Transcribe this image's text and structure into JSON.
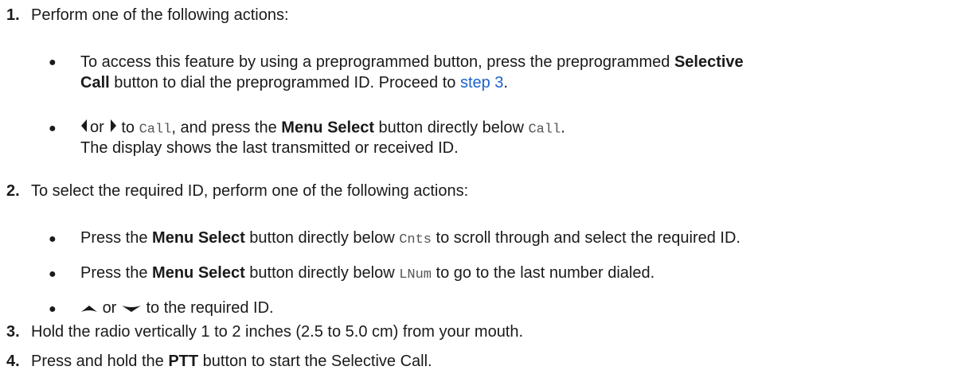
{
  "steps": [
    {
      "number": "1.",
      "text": "Perform one of the following actions:",
      "bullets": [
        {
          "line1_pre": "To access this feature by using a preprogrammed button, press the preprogrammed ",
          "line1_bold": "Selective",
          "line2_bold": "Call",
          "line2_mid": " button to dial the preprogrammed ID. Proceed to ",
          "link": "step 3",
          "line2_end": "."
        },
        {
          "icon_left": "left-arrow-icon",
          "or": "or",
          "icon_right": "right-arrow-icon",
          "to": "to",
          "code1": "Call",
          "mid": ", and press the ",
          "bold": "Menu Select",
          "after": " button directly below ",
          "code2": "Call",
          "end": ".",
          "line2": "The display shows the last transmitted or received ID."
        }
      ]
    },
    {
      "number": "2.",
      "text": "To select the required ID, perform one of the following actions:",
      "bullets": [
        {
          "pre": "Press the ",
          "bold": "Menu Select",
          "mid": " button directly below ",
          "code": "Cnts",
          "end": " to scroll through and select the required ID."
        },
        {
          "pre": "Press the ",
          "bold": "Menu Select",
          "mid": " button directly below ",
          "code": "LNum",
          "end": " to go to the last number dialed."
        },
        {
          "icon_up": "up-arrow-icon",
          "or": "or",
          "icon_down": "down-arrow-icon",
          "end": "to the required ID."
        }
      ]
    },
    {
      "number": "3.",
      "text": "Hold the radio vertically 1 to 2 inches (2.5 to 5.0 cm) from your mouth."
    },
    {
      "number": "4.",
      "pre": "Press and hold the ",
      "bold": "PTT",
      "end": " button to start the Selective Call."
    }
  ],
  "bullet_char": "●",
  "colors": {
    "text": "#1a1a1a",
    "link": "#1a63c8",
    "code": "#555555"
  }
}
